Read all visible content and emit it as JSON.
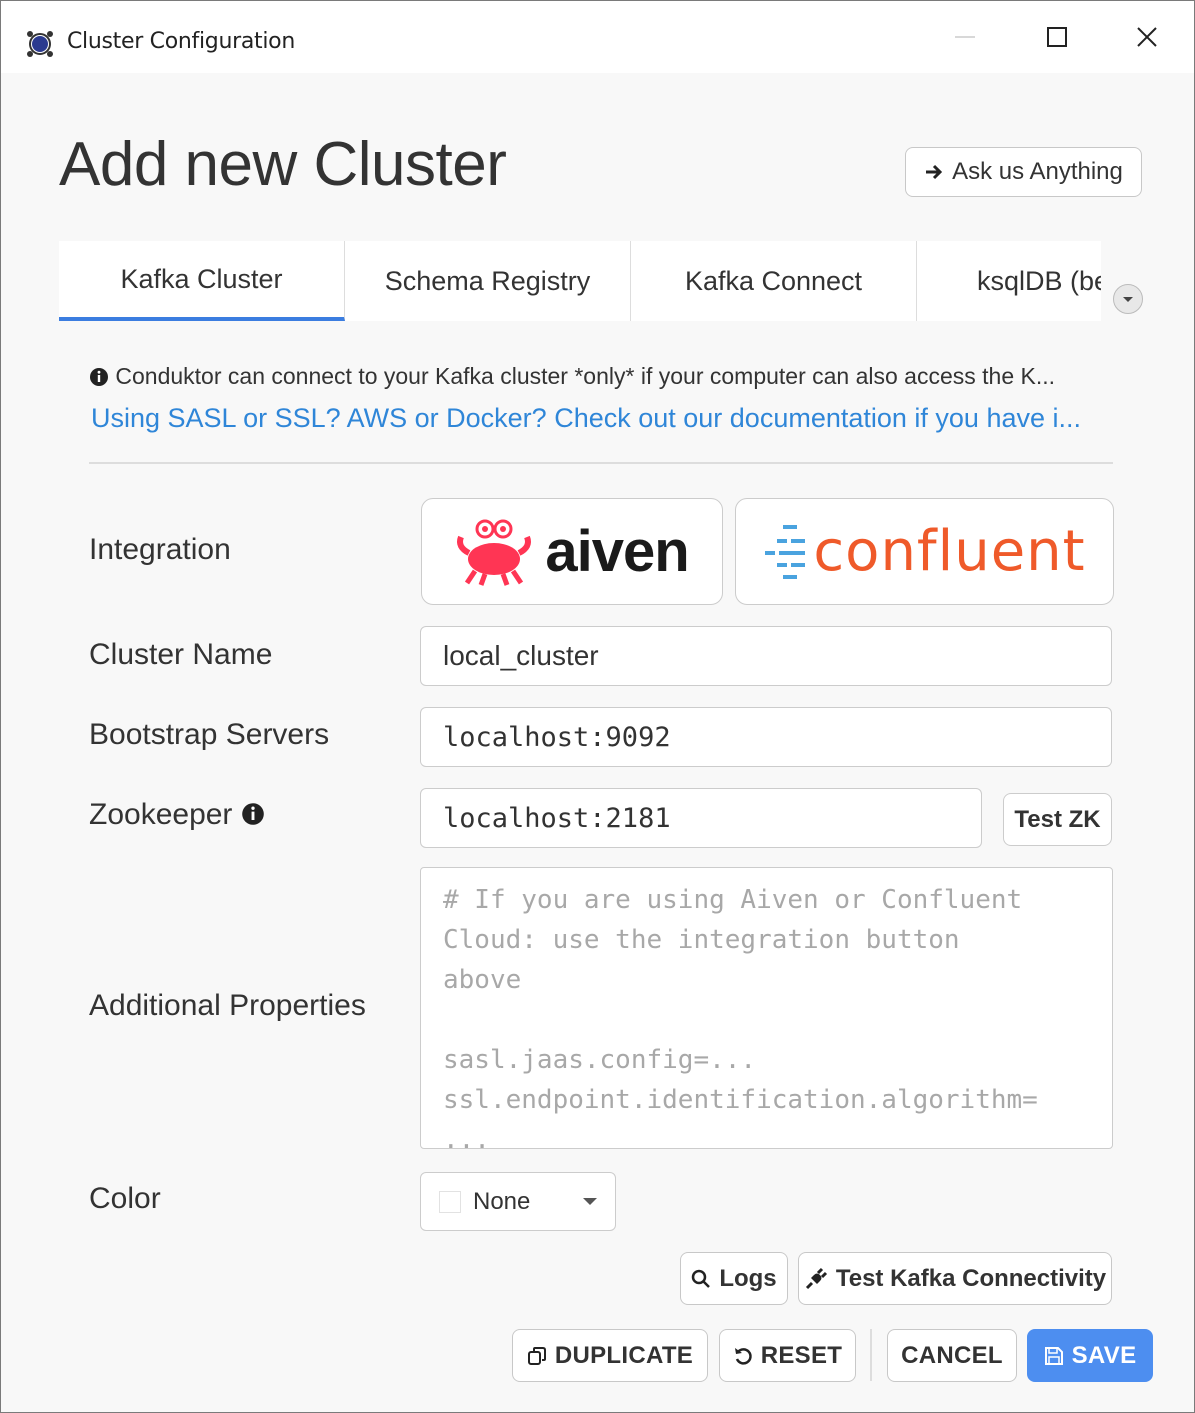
{
  "window": {
    "title": "Cluster Configuration"
  },
  "header": {
    "title": "Add new Cluster",
    "ask_label": "Ask us Anything"
  },
  "tabs": [
    {
      "label": "Kafka Cluster",
      "active": true
    },
    {
      "label": "Schema Registry",
      "active": false
    },
    {
      "label": "Kafka Connect",
      "active": false
    },
    {
      "label": "ksqlDB (be",
      "active": false
    }
  ],
  "info": {
    "notice": "Conduktor can connect to your Kafka cluster *only* if your computer can also access the K...",
    "link": "Using SASL or SSL? AWS or Docker? Check out our documentation if you have i..."
  },
  "form": {
    "integration_label": "Integration",
    "integrations": {
      "aiven": "aiven",
      "confluent": "confluent"
    },
    "cluster_name_label": "Cluster Name",
    "cluster_name_value": "local_cluster",
    "bootstrap_label": "Bootstrap Servers",
    "bootstrap_value": "localhost:9092",
    "zookeeper_label": "Zookeeper",
    "zookeeper_value": "localhost:2181",
    "test_zk_label": "Test ZK",
    "props_label": "Additional Properties",
    "props_placeholder": "# If you are using Aiven or Confluent\nCloud: use the integration button\nabove\n\nsasl.jaas.config=...\nssl.endpoint.identification.algorithm=\n...",
    "color_label": "Color",
    "color_value": "None"
  },
  "actions": {
    "logs": "Logs",
    "test_connectivity": "Test Kafka Connectivity",
    "duplicate": "DUPLICATE",
    "reset": "RESET",
    "cancel": "CANCEL",
    "save": "SAVE"
  },
  "colors": {
    "accent": "#3b7de0",
    "link": "#2f86d8",
    "save": "#4d8ef0",
    "aiven_red": "#ff3554",
    "confluent_orange": "#ef5a2a",
    "confluent_blue": "#4aa3df"
  }
}
